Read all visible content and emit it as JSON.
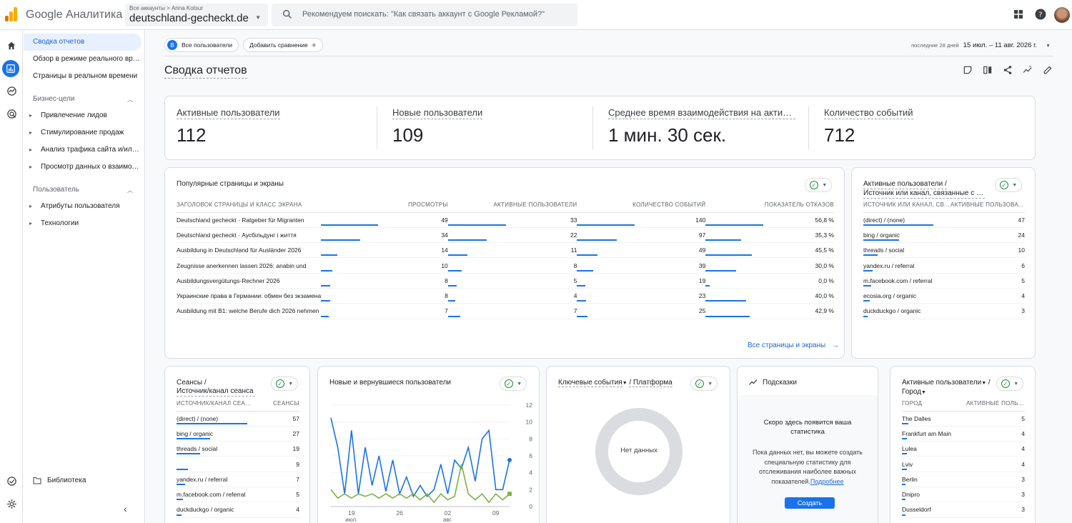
{
  "header": {
    "app_name": "Google Аналитика",
    "breadcrumb_all": "Все аккаунты",
    "breadcrumb_account": "Anna Kotsur",
    "property": "deutschland-gecheckt.de",
    "search_placeholder": "Рекомендуем поискать: \"Как связать аккаунт с Google Рекламой?\""
  },
  "sidebar": {
    "top_items": [
      "Сводка отчетов",
      "Обзор в режиме реального времени",
      "Страницы в реальном времени"
    ],
    "section_business": "Бизнес-цели",
    "business_items": [
      "Привлечение лидов",
      "Стимулирование продаж",
      "Анализ трафика сайта и/или приложения",
      "Просмотр данных о взаимодействии"
    ],
    "section_user": "Пользователь",
    "user_items": [
      "Атрибуты пользователя",
      "Технологии"
    ],
    "library": "Библиотека"
  },
  "filters": {
    "segment_badge": "B",
    "segment": "Все пользователи",
    "add_comparison": "Добавить сравнение",
    "date_prefix": "последние 28 дней",
    "date_range": "15 июл. – 11 авг. 2026 г."
  },
  "page_title": "Сводка отчетов",
  "kpis": [
    {
      "label": "Активные пользователи",
      "value": "112"
    },
    {
      "label": "Новые пользователи",
      "value": "109"
    },
    {
      "label": "Среднее время взаимодействия на активного пользователя",
      "value": "1 мин. 30 сек."
    },
    {
      "label": "Количество событий",
      "value": "712"
    }
  ],
  "pages_card": {
    "title": "Популярные страницы и экраны",
    "columns": [
      "Заголовок страницы и класс экрана",
      "Просмотры",
      "Активные пользователи",
      "Количество событий",
      "Показатель отказов"
    ],
    "rows": [
      [
        "Deutschland gecheckt · Ratgeber für Migranten",
        "49",
        "33",
        "140",
        "56,8 %"
      ],
      [
        "Deutschland gecheckt · Аусбільдунг і життя",
        "34",
        "22",
        "97",
        "35,3 %"
      ],
      [
        "Ausbildung in Deutschland für Ausländer 2026",
        "14",
        "11",
        "49",
        "45,5 %"
      ],
      [
        "Zeugnisse anerkennen lassen 2026: anabin und",
        "10",
        "8",
        "39",
        "30,0 %"
      ],
      [
        "Ausbildungsvergütungs-Rechner 2026",
        "8",
        "5",
        "19",
        "0,0 %"
      ],
      [
        "Украинские права в Германии: обмен без экзамена",
        "8",
        "4",
        "23",
        "40,0 %"
      ],
      [
        "Ausbildung mit B1: welche Berufe dich 2026 nehmen",
        "7",
        "7",
        "25",
        "42,9 %"
      ]
    ],
    "bar_fractions": [
      [
        1.0,
        1.0,
        1.0,
        1.0
      ],
      [
        0.69,
        0.67,
        0.69,
        0.62
      ],
      [
        0.29,
        0.33,
        0.35,
        0.8
      ],
      [
        0.2,
        0.24,
        0.28,
        0.53
      ],
      [
        0.16,
        0.15,
        0.14,
        0.0
      ],
      [
        0.16,
        0.12,
        0.16,
        0.7
      ],
      [
        0.14,
        0.21,
        0.18,
        0.76
      ]
    ],
    "more_link": "Все страницы и экраны"
  },
  "source_card": {
    "title_line1": "Активные пользователи /",
    "title_line2": "Источник или канал, связанные с первым посещением",
    "columns": [
      "Источник или канал, связанные с первым посещением",
      "Активные пользователи"
    ],
    "rows": [
      [
        "(direct) / (none)",
        "47"
      ],
      [
        "bing / organic",
        "24"
      ],
      [
        "threads / social",
        "10"
      ],
      [
        "yandex.ru / referral",
        "6"
      ],
      [
        "m.facebook.com / referral",
        "5"
      ],
      [
        "ecosia.org / organic",
        "4"
      ],
      [
        "duckduckgo / organic",
        "3"
      ]
    ],
    "bar_fractions": [
      1.0,
      0.51,
      0.21,
      0.13,
      0.11,
      0.09,
      0.06
    ]
  },
  "sessions_card": {
    "title_line1": "Сеансы /",
    "title_line2": "Источник/канал сеанса",
    "columns": [
      "Источник/канал сеанса",
      "Сеансы"
    ],
    "rows": [
      [
        "(direct) / (none)",
        "57"
      ],
      [
        "bing / organic",
        "27"
      ],
      [
        "threads / social",
        "19"
      ],
      [
        "",
        "9"
      ],
      [
        "yandex.ru / referral",
        "7"
      ],
      [
        "m.facebook.com / referral",
        "5"
      ],
      [
        "duckduckgo / organic",
        "4"
      ]
    ],
    "bar_fractions": [
      1.0,
      0.47,
      0.33,
      0.16,
      0.12,
      0.09,
      0.07
    ]
  },
  "chart_card": {
    "title": "Новые и вернувшиеся пользователи"
  },
  "chart_data": {
    "type": "line",
    "x_ticks": [
      {
        "day": "19",
        "month": "июл."
      },
      {
        "day": "26",
        "month": ""
      },
      {
        "day": "02",
        "month": "авг."
      },
      {
        "day": "09",
        "month": ""
      }
    ],
    "y_ticks": [
      "12",
      "10",
      "8",
      "6",
      "4",
      "2",
      "0"
    ],
    "ylim": [
      0,
      12
    ],
    "series": [
      {
        "color": "#1a73e8",
        "values": [
          10.5,
          7,
          1.5,
          9,
          1.5,
          7,
          2.5,
          6,
          1.8,
          5.5,
          1.5,
          3.5,
          1.2,
          2.5,
          1.2,
          2,
          5,
          1.5,
          5.5,
          4.5,
          7,
          3,
          8,
          9,
          2,
          2,
          5.5
        ]
      },
      {
        "color": "#7cb342",
        "values": [
          2,
          1,
          1.5,
          1,
          1.5,
          1.2,
          1.5,
          1,
          1.5,
          1,
          1.5,
          1,
          1.5,
          0.8,
          1.5,
          0.5,
          1.5,
          0.8,
          1.2,
          5,
          1.5,
          0.8,
          1.5,
          0.5,
          1.5,
          0.8,
          1.5
        ]
      }
    ]
  },
  "events_card": {
    "title_part1": "Ключевые события",
    "title_part2": "/ Платформа",
    "no_data": "Нет данных"
  },
  "hints_card": {
    "title": "Подсказки",
    "heading": "Скоро здесь появится ваша статистика",
    "text": "Пока данных нет, вы можете создать специальную статистику для отслеживания наиболее важных показателей.",
    "link": "Подробнее",
    "button": "Создать"
  },
  "city_card": {
    "title_line1": "Активные пользователи",
    "title_line1_suffix": "/",
    "title_line2": "Город",
    "columns": [
      "Город",
      "Активные пользователи"
    ],
    "rows": [
      [
        "The Dalles",
        "5"
      ],
      [
        "Frankfurt am Main",
        "4"
      ],
      [
        "Lulea",
        "4"
      ],
      [
        "Lviv",
        "4"
      ],
      [
        "Berlin",
        "3"
      ],
      [
        "Dnipro",
        "3"
      ],
      [
        "Dusseldorf",
        "3"
      ]
    ],
    "bar_fractions": [
      1.0,
      0.8,
      0.8,
      0.8,
      0.6,
      0.6,
      0.6
    ]
  },
  "colors": {
    "accent": "#1a73e8",
    "returning": "#7cb342"
  }
}
